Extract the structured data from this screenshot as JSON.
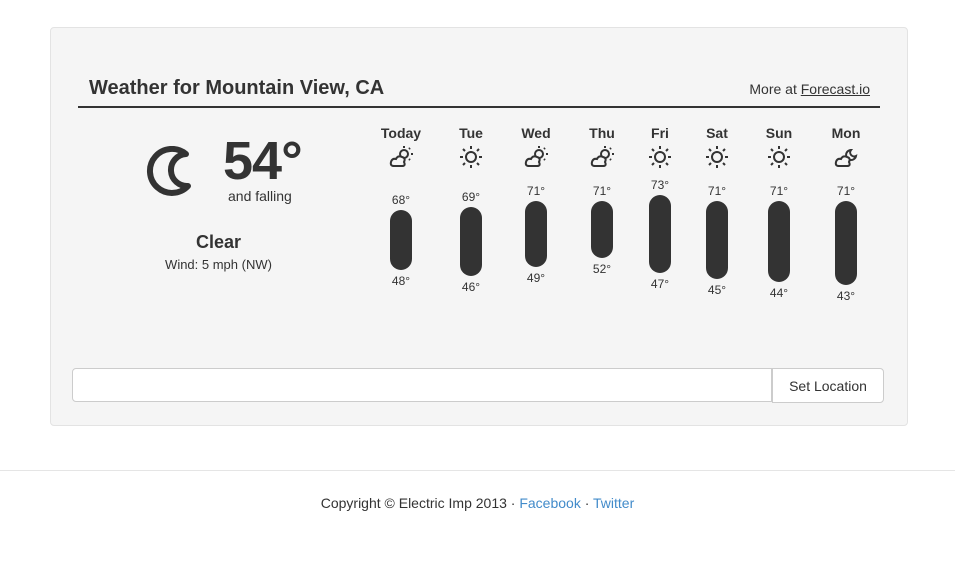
{
  "header": {
    "title": "Weather for Mountain View, CA",
    "more_prefix": "More at ",
    "more_link": "Forecast.io"
  },
  "current": {
    "icon": "moon-icon",
    "temperature": "54°",
    "trend": "and falling",
    "condition": "Clear",
    "wind": "Wind: 5 mph (NW)"
  },
  "forecast": [
    {
      "day": "Today",
      "icon": "partly-cloudy-icon",
      "high": 68,
      "low": 48
    },
    {
      "day": "Tue",
      "icon": "sun-icon",
      "high": 69,
      "low": 46
    },
    {
      "day": "Wed",
      "icon": "partly-cloudy-icon",
      "high": 71,
      "low": 49
    },
    {
      "day": "Thu",
      "icon": "partly-cloudy-icon",
      "high": 71,
      "low": 52
    },
    {
      "day": "Fri",
      "icon": "sun-icon",
      "high": 73,
      "low": 47
    },
    {
      "day": "Sat",
      "icon": "sun-icon",
      "high": 71,
      "low": 45
    },
    {
      "day": "Sun",
      "icon": "sun-icon",
      "high": 71,
      "low": 44
    },
    {
      "day": "Mon",
      "icon": "cloudy-night-icon",
      "high": 71,
      "low": 43
    }
  ],
  "location": {
    "value": "",
    "button": "Set Location"
  },
  "footer": {
    "copyright": "Copyright © Electric Imp 2013 · ",
    "facebook": "Facebook",
    "sep": " · ",
    "twitter": "Twitter"
  }
}
